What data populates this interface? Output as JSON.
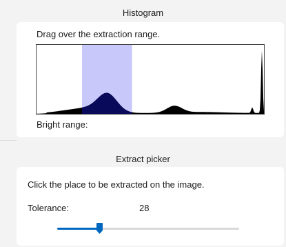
{
  "histogram": {
    "title": "Histogram",
    "instruction": "Drag over the extraction range.",
    "bright_range_label": "Bright range:",
    "selection": {
      "start": 0.2,
      "end": 0.42
    },
    "selection_color": "#c8c8fa",
    "fill_color": "#000000",
    "highlight_fill_color": "#0a0a5a"
  },
  "extract_picker": {
    "title": "Extract picker",
    "instruction": "Click the place to be extracted on the image.",
    "tolerance_label": "Tolerance:",
    "tolerance_value": "28",
    "tolerance_fraction": 0.23,
    "accent_color": "#0067c0"
  }
}
